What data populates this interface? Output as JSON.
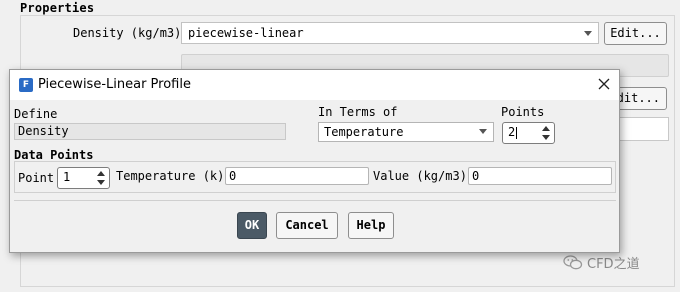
{
  "properties": {
    "title": "Properties",
    "density_label": "Density (kg/m3)",
    "density_method": "piecewise-linear",
    "edit_label": "Edit...",
    "edit_label_partial": "dit..."
  },
  "watermark": {
    "text": "CFD之道",
    "icon": "wechat-icon"
  },
  "dialog": {
    "title": "Piecewise-Linear Profile",
    "icon": "fluent-app-icon",
    "define_label": "Define",
    "define_value": "Density",
    "in_terms_of_label": "In Terms of",
    "in_terms_of_value": "Temperature",
    "points_label": "Points",
    "points_value": "2",
    "data_points_label": "Data Points",
    "point_label": "Point",
    "point_value": "1",
    "temperature_label": "Temperature (k)",
    "temperature_value": "0",
    "value_label": "Value (kg/m3)",
    "value_value": "0",
    "ok_label": "OK",
    "cancel_label": "Cancel",
    "help_label": "Help"
  }
}
